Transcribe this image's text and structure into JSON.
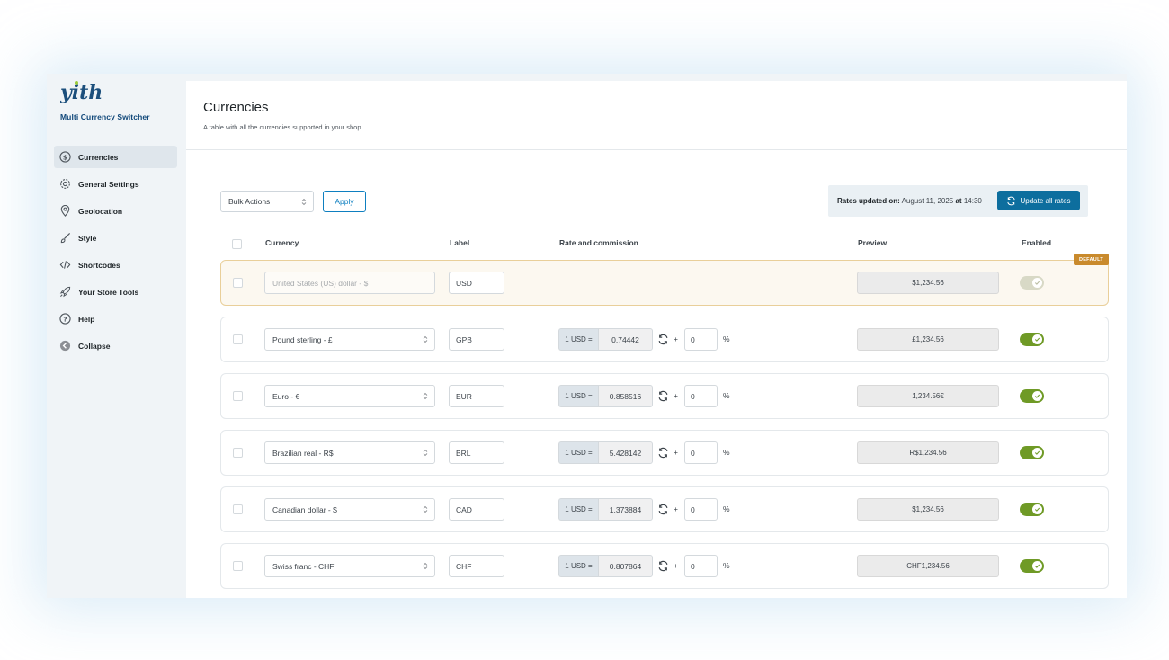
{
  "sidebar": {
    "brand_name": "Multi Currency Switcher",
    "items": [
      {
        "label": "Currencies",
        "icon": "dollar-circle-icon"
      },
      {
        "label": "General Settings",
        "icon": "gear-icon"
      },
      {
        "label": "Geolocation",
        "icon": "map-pin-icon"
      },
      {
        "label": "Style",
        "icon": "brush-icon"
      },
      {
        "label": "Shortcodes",
        "icon": "code-icon"
      },
      {
        "label": "Your Store Tools",
        "icon": "rocket-icon"
      },
      {
        "label": "Help",
        "icon": "help-icon"
      },
      {
        "label": "Collapse",
        "icon": "collapse-icon"
      }
    ]
  },
  "page": {
    "title": "Currencies",
    "description": "A table with all the currencies supported in your shop."
  },
  "toolbar": {
    "bulk_actions": "Bulk Actions",
    "apply": "Apply",
    "rates_label": "Rates updated on:",
    "rates_date": "August 11, 2025",
    "rates_at": "at",
    "rates_time": "14:30",
    "update_all": "Update all rates"
  },
  "table": {
    "headers": {
      "currency": "Currency",
      "label": "Label",
      "rate": "Rate and commission",
      "preview": "Preview",
      "enabled": "Enabled"
    },
    "default_badge": "DEFAULT",
    "rows": [
      {
        "currency": "United States (US) dollar - $",
        "label": "USD",
        "preview": "$1,234.56",
        "is_default": true,
        "enabled": true
      },
      {
        "currency": "Pound sterling - £",
        "label": "GPB",
        "rate_prefix": "1 USD =",
        "rate": "0.74442",
        "plus": "+",
        "commission": "0",
        "pct": "%",
        "preview": "£1,234.56",
        "enabled": true
      },
      {
        "currency": "Euro - €",
        "label": "EUR",
        "rate_prefix": "1 USD =",
        "rate": "0.858516",
        "plus": "+",
        "commission": "0",
        "pct": "%",
        "preview": "1,234.56€",
        "enabled": true
      },
      {
        "currency": "Brazilian real - R$",
        "label": "BRL",
        "rate_prefix": "1 USD =",
        "rate": "5.428142",
        "plus": "+",
        "commission": "0",
        "pct": "%",
        "preview": "R$1,234.56",
        "enabled": true
      },
      {
        "currency": "Canadian dollar - $",
        "label": "CAD",
        "rate_prefix": "1 USD =",
        "rate": "1.373884",
        "plus": "+",
        "commission": "0",
        "pct": "%",
        "preview": "$1,234.56",
        "enabled": true
      },
      {
        "currency": "Swiss franc - CHF",
        "label": "CHF",
        "rate_prefix": "1 USD =",
        "rate": "0.807864",
        "plus": "+",
        "commission": "0",
        "pct": "%",
        "preview": "CHF1,234.56",
        "enabled": true
      }
    ]
  },
  "colors": {
    "accent": "#0d6e9e",
    "toggle_on": "#6f9a26",
    "default_badge": "#c98a2c"
  }
}
